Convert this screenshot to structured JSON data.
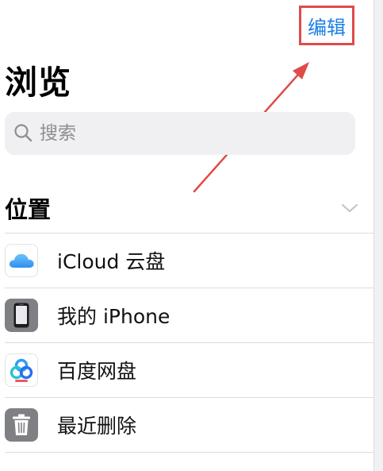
{
  "header": {
    "edit_label": "编辑"
  },
  "page": {
    "title": "浏览"
  },
  "search": {
    "placeholder": "搜索"
  },
  "locations": {
    "title": "位置",
    "items": [
      {
        "label": "iCloud 云盘",
        "icon": "icloud-icon"
      },
      {
        "label": "我的 iPhone",
        "icon": "iphone-icon"
      },
      {
        "label": "百度网盘",
        "icon": "baidu-netdisk-icon"
      },
      {
        "label": "最近删除",
        "icon": "trash-icon"
      }
    ]
  },
  "colors": {
    "accent": "#1a7fe8",
    "annotation": "#e04a4a"
  }
}
